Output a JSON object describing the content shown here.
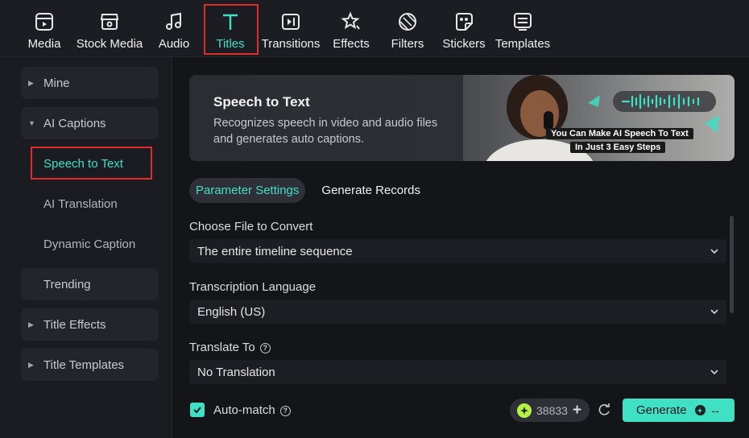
{
  "toolbar": {
    "items": [
      {
        "label": "Media",
        "icon": "media-icon"
      },
      {
        "label": "Stock Media",
        "icon": "stock-media-icon"
      },
      {
        "label": "Audio",
        "icon": "music-note-icon"
      },
      {
        "label": "Titles",
        "icon": "text-t-icon",
        "active": true
      },
      {
        "label": "Transitions",
        "icon": "transitions-icon"
      },
      {
        "label": "Effects",
        "icon": "effects-star-icon"
      },
      {
        "label": "Filters",
        "icon": "filters-icon"
      },
      {
        "label": "Stickers",
        "icon": "sticker-icon"
      },
      {
        "label": "Templates",
        "icon": "templates-icon"
      }
    ],
    "active_color": "#3fe0c4"
  },
  "sidebar": {
    "items": [
      {
        "label": "Mine",
        "type": "group",
        "expanded": false
      },
      {
        "label": "AI Captions",
        "type": "group",
        "expanded": true
      },
      {
        "label": "Speech to Text",
        "type": "subitem",
        "selected": true
      },
      {
        "label": "AI Translation",
        "type": "subitem"
      },
      {
        "label": "Dynamic Caption",
        "type": "subitem"
      },
      {
        "label": "Trending",
        "type": "group-flat"
      },
      {
        "label": "Title Effects",
        "type": "group",
        "expanded": false
      },
      {
        "label": "Title Templates",
        "type": "group",
        "expanded": false
      }
    ]
  },
  "banner": {
    "title": "Speech to Text",
    "description": "Recognizes speech in video and audio files and generates auto captions.",
    "overlay_line1": "You Can Make AI Speech To Text",
    "overlay_line2": "In Just  3 Easy Steps"
  },
  "tabs": {
    "parameter_settings": "Parameter Settings",
    "generate_records": "Generate Records"
  },
  "form": {
    "file_label": "Choose File to Convert",
    "file_value": "The entire timeline sequence",
    "language_label": "Transcription Language",
    "language_value": "English (US)",
    "translate_label": "Translate To",
    "translate_value": "No Translation"
  },
  "footer": {
    "auto_match_label": "Auto-match",
    "auto_match_checked": true,
    "credits": "38833",
    "generate_label": "Generate",
    "generate_cost": "--"
  },
  "colors": {
    "accent": "#3fe0c4",
    "highlight_box": "#e02b2b",
    "credit_coin": "#b6f046"
  }
}
